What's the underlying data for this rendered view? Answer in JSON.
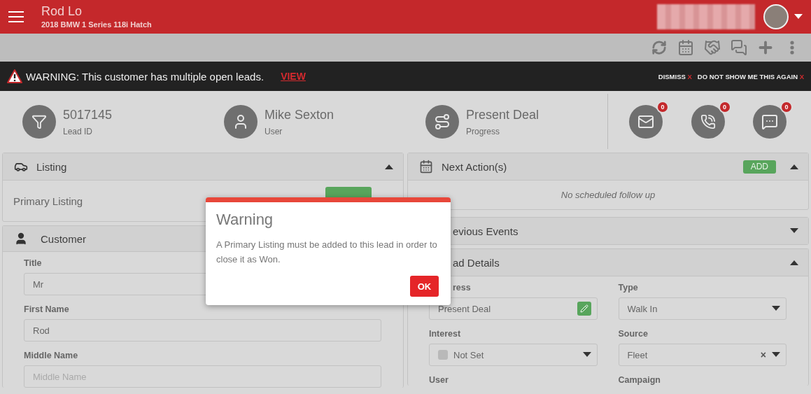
{
  "header": {
    "title": "Rod Lo",
    "subtitle": "2018 BMW 1 Series 118i Hatch"
  },
  "alert": {
    "message": "WARNING: This customer has multiple open leads.",
    "link": "VIEW",
    "actions": [
      {
        "label": "DISMISS",
        "mark": "X"
      },
      {
        "label": "DO NOT SHOW ME THIS AGAIN",
        "mark": "X"
      }
    ]
  },
  "stats": [
    {
      "kind": "lead",
      "value": "5017145",
      "label": "Lead ID"
    },
    {
      "kind": "user",
      "value": "Mike Sexton",
      "label": "User"
    },
    {
      "kind": "progress",
      "value": "Present Deal",
      "label": "Progress"
    }
  ],
  "counters": [
    {
      "kind": "email",
      "count": "0"
    },
    {
      "kind": "phone",
      "count": "0"
    },
    {
      "kind": "sms",
      "count": "0"
    }
  ],
  "listing_panel": {
    "title": "Listing",
    "expanded": true,
    "row_label": "Primary Listing"
  },
  "customer_panel": {
    "title": "Customer",
    "fields": [
      {
        "label": "Title",
        "value": "Mr"
      },
      {
        "label": "First Name",
        "value": "Rod"
      },
      {
        "label": "Middle Name",
        "placeholder": "Middle Name"
      }
    ]
  },
  "next_actions_panel": {
    "title": "Next Action(s)",
    "button": "ADD",
    "expanded": true,
    "empty_text": "No scheduled follow up"
  },
  "previous_events_panel": {
    "title": "evious Events",
    "expanded": false
  },
  "lead_details_panel": {
    "title": "ad Details",
    "expanded": true,
    "fields": [
      {
        "kind": "edit",
        "label": "ress",
        "value": "Present Deal"
      },
      {
        "kind": "select",
        "label": "Type",
        "value": "Walk In"
      },
      {
        "kind": "interest",
        "label": "Interest",
        "value": "Not Set"
      },
      {
        "kind": "clearable",
        "label": "Source",
        "value": "Fleet",
        "clear": "×"
      },
      {
        "kind": "label",
        "label": "User"
      },
      {
        "kind": "label",
        "label": "Campaign"
      }
    ]
  },
  "dialog": {
    "title": "Warning",
    "message": "A Primary Listing must be added to this lead in order to close it as Won.",
    "button": "OK"
  }
}
